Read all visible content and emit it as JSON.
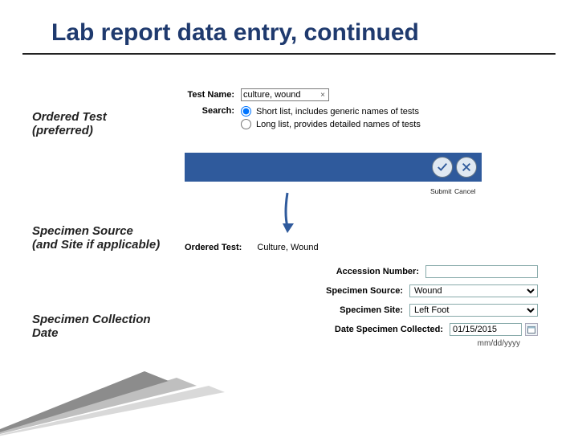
{
  "title": "Lab report data entry, continued",
  "side_labels": {
    "ordered_test": "Ordered Test (preferred)",
    "specimen_source": "Specimen Source (and Site if applicable)",
    "specimen_date": "Specimen Collection Date"
  },
  "top_form": {
    "test_name_label": "Test Name:",
    "test_name_value": "culture, wound",
    "search_label": "Search:",
    "radio_short_label": "Short list, includes generic names of tests",
    "radio_long_label": "Long list, provides detailed names of tests",
    "radio_selected": "short"
  },
  "button_bar": {
    "submit_label": "Submit",
    "cancel_label": "Cancel"
  },
  "lower_form": {
    "ordered_test_label": "Ordered Test:",
    "ordered_test_value": "Culture, Wound",
    "accession_label": "Accession Number:",
    "accession_value": "",
    "specimen_source_label": "Specimen Source:",
    "specimen_source_value": "Wound",
    "specimen_site_label": "Specimen Site:",
    "specimen_site_value": "Left Foot",
    "date_collected_label": "Date Specimen Collected:",
    "date_collected_value": "01/15/2015",
    "date_hint": "mm/dd/yyyy"
  }
}
